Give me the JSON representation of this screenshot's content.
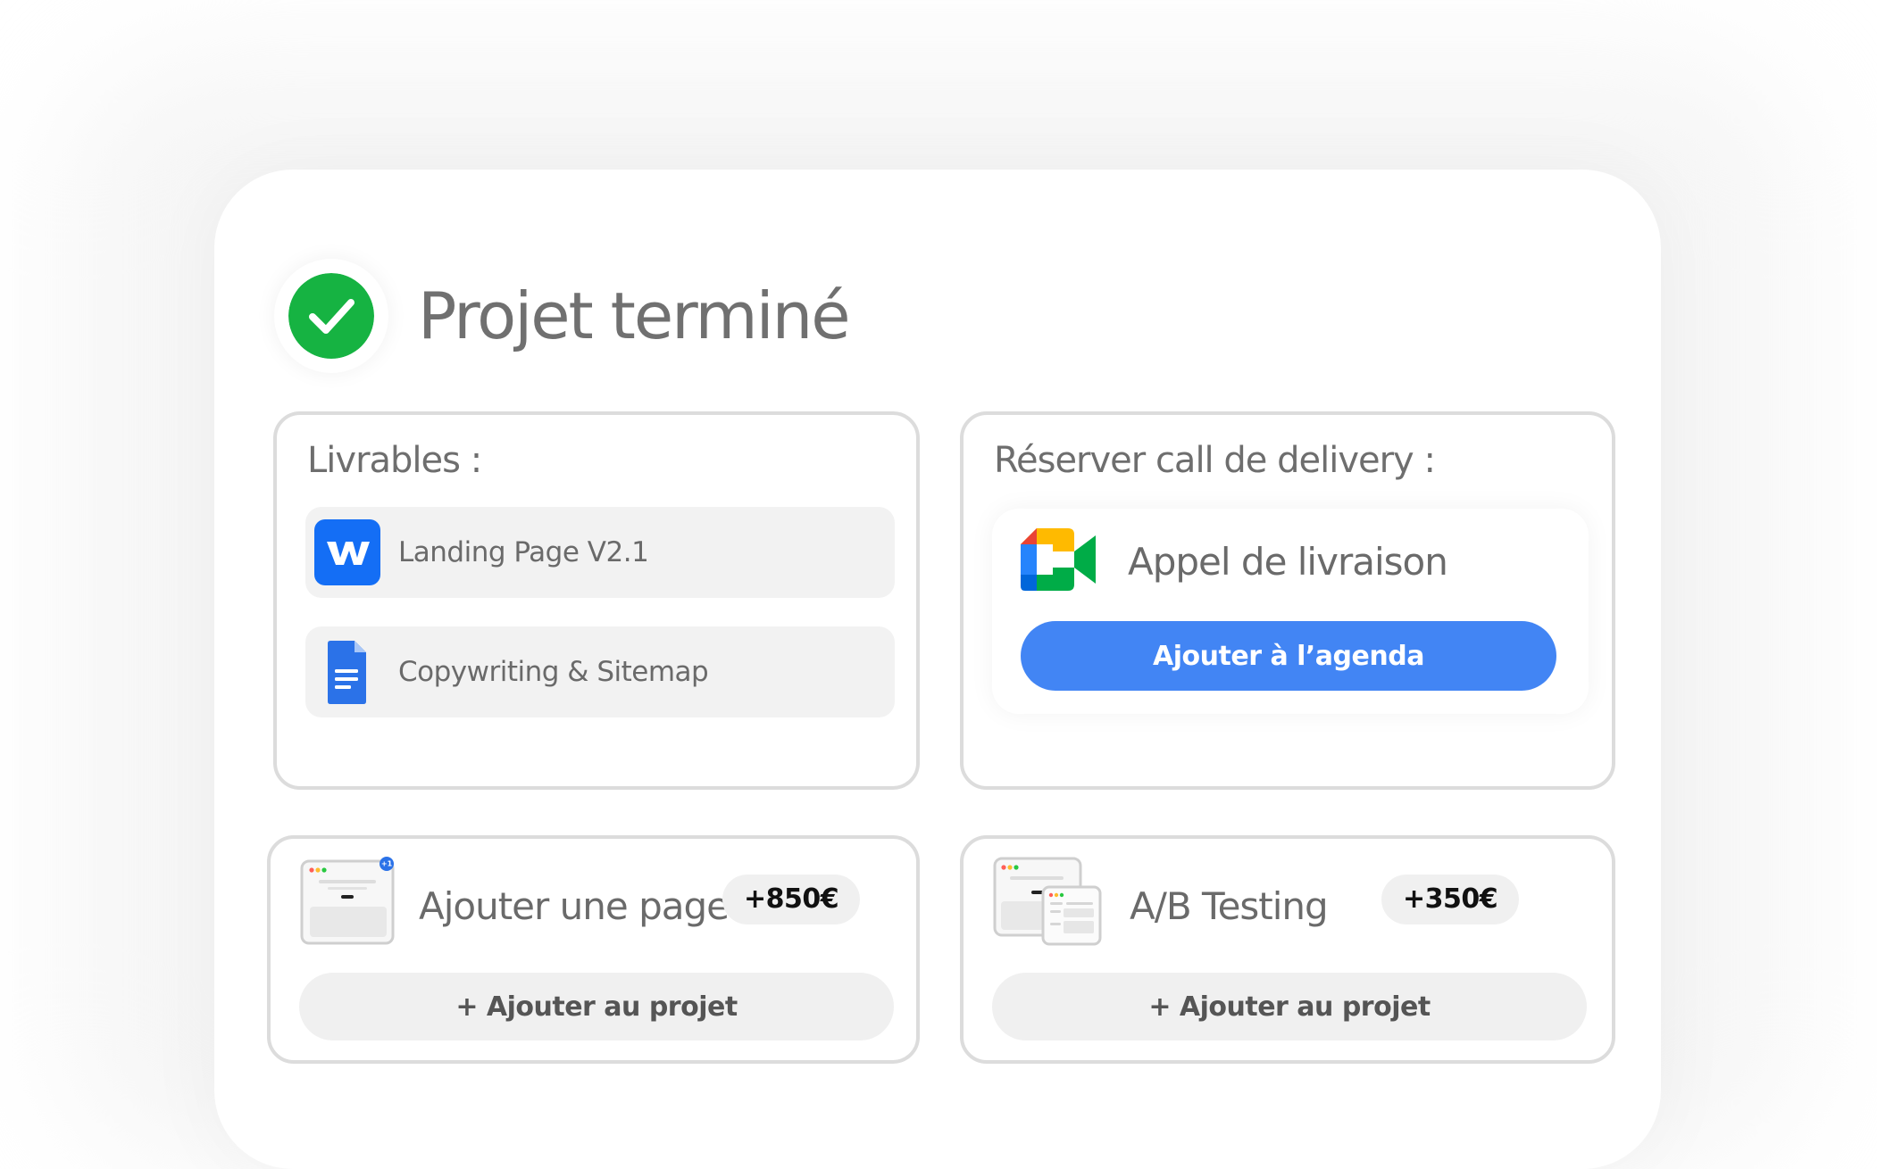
{
  "header": {
    "status_icon": "check-circle-icon",
    "title": "Projet terminé"
  },
  "deliverables": {
    "title": "Livrables :",
    "items": [
      {
        "label": "Landing Page V2.1",
        "icon": "webflow-logo-icon"
      },
      {
        "label": "Copywriting & Sitemap",
        "icon": "google-docs-icon"
      }
    ]
  },
  "delivery_call": {
    "title": "Réserver call de delivery :",
    "event_icon": "google-meet-icon",
    "event_title": "Appel de livraison",
    "button_label": "Ajouter à l’agenda"
  },
  "addons": [
    {
      "title": "Ajouter une page",
      "price": "+850€",
      "badge_text": "+1",
      "button_label": "+ Ajouter au projet"
    },
    {
      "title": "A/B Testing",
      "price": "+350€",
      "button_label": "+ Ajouter au projet"
    }
  ],
  "colors": {
    "success_green": "#16b342",
    "primary_blue": "#4285f4",
    "webflow_blue": "#146ef5",
    "docs_blue": "#2b72e8",
    "text_gray": "#6a6a6a",
    "border_gray": "#dcdcdc"
  }
}
